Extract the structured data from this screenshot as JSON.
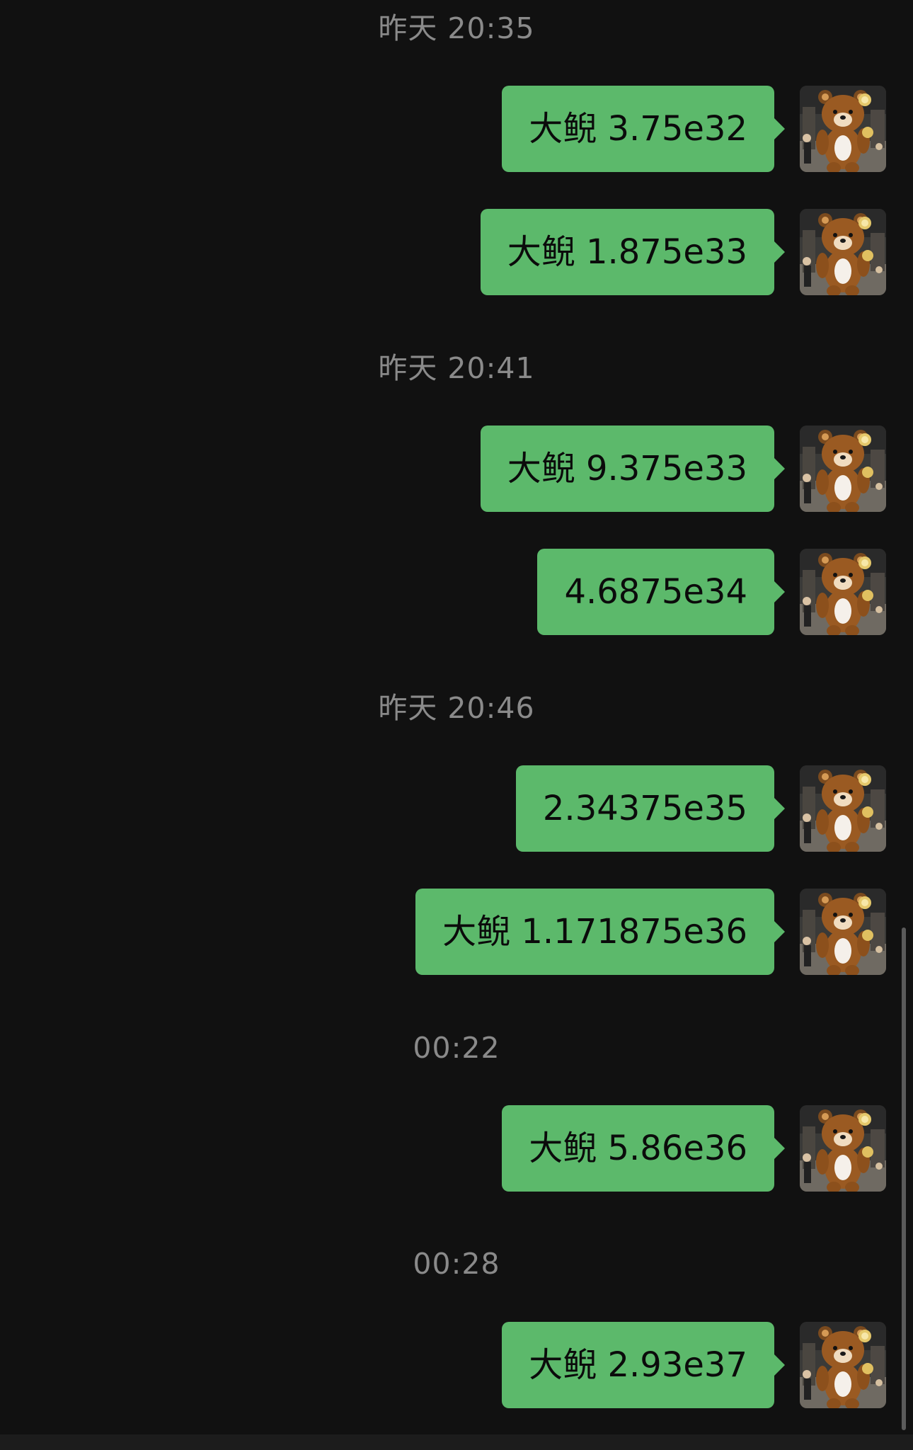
{
  "timestamps": [
    {
      "label": "昨天 20:35"
    },
    {
      "label": "昨天 20:41"
    },
    {
      "label": "昨天 20:46"
    },
    {
      "label": "00:22"
    },
    {
      "label": "00:28"
    }
  ],
  "messages": [
    {
      "text": "大鲵 3.75e32",
      "sender": "self"
    },
    {
      "text": "大鲵 1.875e33",
      "sender": "self"
    },
    {
      "text": "大鲵 9.375e33",
      "sender": "self"
    },
    {
      "text": "4.6875e34",
      "sender": "self"
    },
    {
      "text": "2.34375e35",
      "sender": "self"
    },
    {
      "text": "大鲵 1.171875e36",
      "sender": "self"
    },
    {
      "text": "大鲵 5.86e36",
      "sender": "self"
    },
    {
      "text": "大鲵 2.93e37",
      "sender": "self"
    }
  ],
  "theme": {
    "background": "#111111",
    "bubble": "#5cb96b",
    "timestamp_text": "#8a8a8a"
  },
  "avatar": {
    "icon": "bear-mascot-avatar"
  }
}
